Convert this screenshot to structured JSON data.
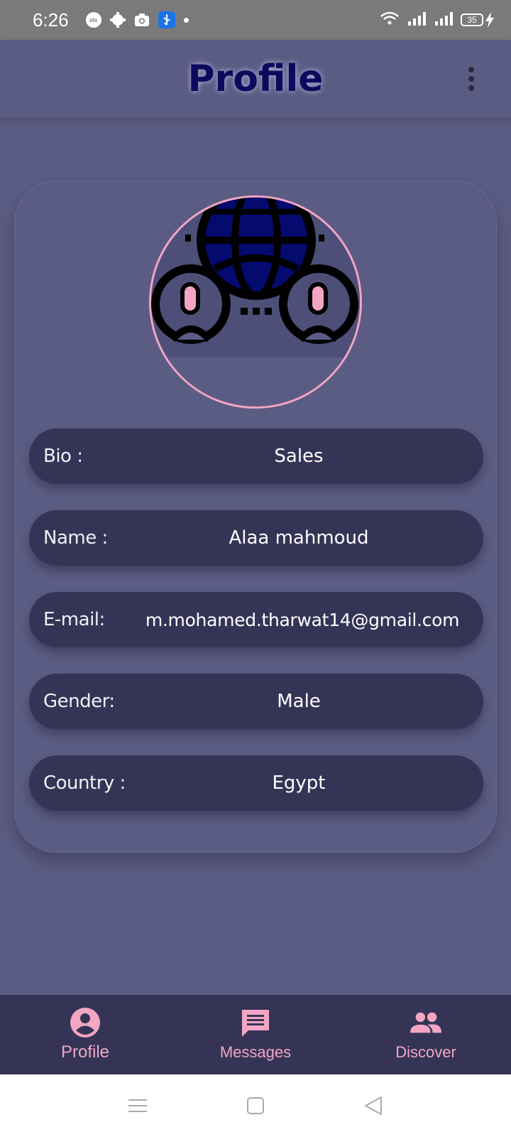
{
  "status_bar": {
    "time": "6:26",
    "olx_badge": "olx",
    "battery_level": "35",
    "icons": [
      "olx-app-icon",
      "settings-icon",
      "camera-icon",
      "usb-icon",
      "notification-dot",
      "wifi-icon",
      "signal-icon",
      "signal-icon",
      "battery-icon",
      "charging-icon"
    ]
  },
  "header": {
    "title": "Profile",
    "menu_icon": "more-vertical-icon"
  },
  "profile": {
    "fields": [
      {
        "label": "Bio :",
        "value": "Sales"
      },
      {
        "label": "Name :",
        "value": "Alaa mahmoud"
      },
      {
        "label": "E-mail:",
        "value": "m.mohamed.tharwat14@gmail.com"
      },
      {
        "label": "Gender:",
        "value": "Male"
      },
      {
        "label": "Country :",
        "value": "Egypt"
      }
    ]
  },
  "bottom_nav": {
    "items": [
      {
        "label": "Profile",
        "icon": "account-circle-icon",
        "active": true
      },
      {
        "label": "Messages",
        "icon": "message-icon",
        "active": false
      },
      {
        "label": "Discover",
        "icon": "people-icon",
        "active": false
      }
    ]
  },
  "colors": {
    "background": "#5b5c83",
    "field_bg": "#353456",
    "accent_pink": "#f2a6c4",
    "title_navy": "#0b0b5e"
  }
}
